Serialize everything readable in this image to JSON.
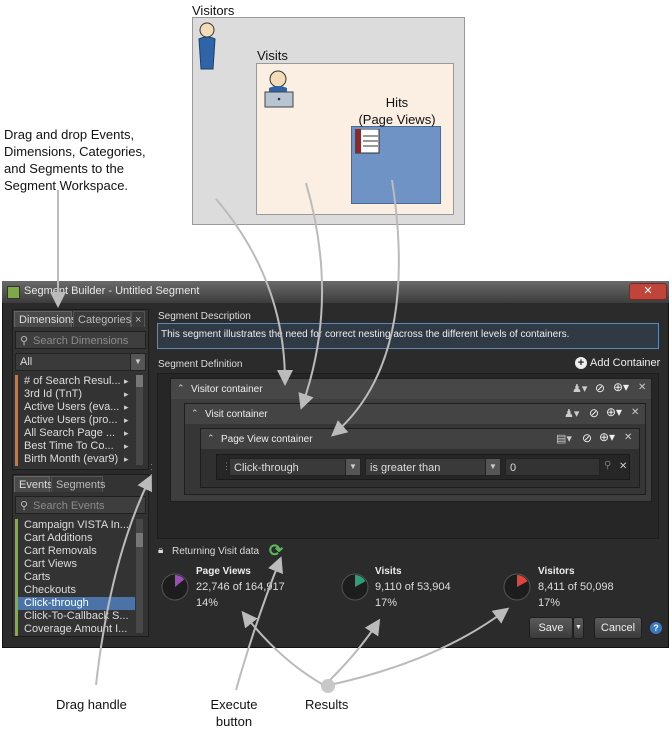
{
  "diagram": {
    "visitors_label": "Visitors",
    "visits_label": "Visits",
    "hits_label_line1": "Hits",
    "hits_label_line2": "(Page Views)"
  },
  "annotations": {
    "drag_drop_line1": "Drag and drop Events,",
    "drag_drop_line2": "Dimensions, Categories,",
    "drag_drop_line3": "and Segments to the",
    "drag_drop_line4": "Segment Workspace.",
    "drag_handle": "Drag handle",
    "execute_line1": "Execute",
    "execute_line2": "button",
    "results": "Results"
  },
  "window": {
    "title": "Segment Builder - Untitled Segment",
    "close_label": "✕"
  },
  "left_panel": {
    "tabs": [
      "Dimensions",
      "Categories"
    ],
    "tab_close": "×",
    "search_placeholder": "Search Dimensions",
    "filter_value": "All",
    "dimensions": [
      "# of Search Resul...",
      "3rd Id (TnT)",
      "Active Users (eva...",
      "Active Users (pro...",
      "All Search Page ...",
      "Best Time To Co...",
      "Birth Month (evar9)"
    ],
    "events_tabs": [
      "Events",
      "Segments"
    ],
    "events_search_placeholder": "Search Events",
    "events": [
      "Campaign VISTA In...",
      "Cart Additions",
      "Cart Removals",
      "Cart Views",
      "Carts",
      "Checkouts",
      "Click-through",
      "Click-To-Callback S...",
      "Coverage Amount I..."
    ],
    "selected_event": "Click-through"
  },
  "segment": {
    "description_label": "Segment Description",
    "description_text": "This segment illustrates the need for correct nesting across the different levels of containers.",
    "definition_label": "Segment Definition",
    "add_container": "Add Container",
    "visitor_container": "Visitor container",
    "visit_container": "Visit container",
    "pageview_container": "Page View container",
    "rule_field": "Click-through",
    "rule_operator": "is greater than",
    "rule_value": "0"
  },
  "results": {
    "label": "Returning Visit data",
    "metrics": [
      {
        "title": "Page Views",
        "counts": "22,746 of 164,917",
        "pct": "14%",
        "fraction": 0.14,
        "color": "#9b4fb5"
      },
      {
        "title": "Visits",
        "counts": "9,110 of 53,904",
        "pct": "17%",
        "fraction": 0.17,
        "color": "#2f9d78"
      },
      {
        "title": "Visitors",
        "counts": "8,411 of 50,098",
        "pct": "17%",
        "fraction": 0.17,
        "color": "#e0443a"
      }
    ]
  },
  "footer": {
    "save": "Save",
    "cancel": "Cancel",
    "help": "?"
  },
  "colors": {
    "dimension_accent": "#d8732f",
    "event_accent": "#7fb236",
    "selection": "#4b73a8",
    "refresh_icon": "#5cb85c"
  }
}
